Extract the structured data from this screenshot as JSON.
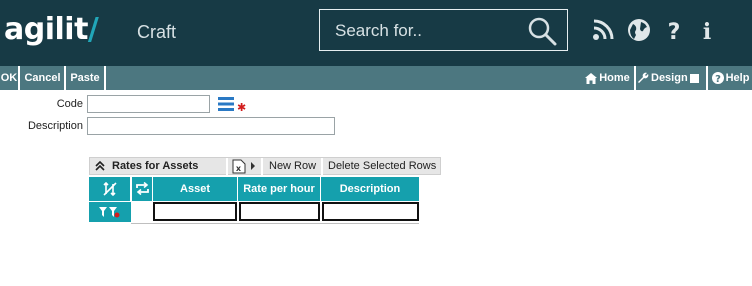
{
  "header": {
    "logo_text": "agilit",
    "logo_slash": "/",
    "app_title": "Craft",
    "search_placeholder": "Search for..",
    "icons": [
      "rss-icon",
      "globe-icon",
      "help-icon",
      "info-icon"
    ],
    "bg_color": "#173a45",
    "accent": "#21a6b8"
  },
  "toolbar": {
    "ok_label": "OK",
    "cancel_label": "Cancel",
    "paste_label": "Paste",
    "home_label": "Home",
    "design_label": "Design",
    "help_label": "Help",
    "bg_color": "#4c7780"
  },
  "form": {
    "code_label": "Code",
    "code_value": "",
    "description_label": "Description",
    "description_value": "",
    "required_marker": "✱"
  },
  "grid": {
    "panel_title": "Rates for Assets",
    "new_row_label": "New Row",
    "delete_rows_label": "Delete Selected Rows",
    "columns": [
      "Asset",
      "Rate per hour",
      "Description"
    ],
    "rows": [
      {
        "asset": "",
        "rate_per_hour": "",
        "description": ""
      }
    ],
    "header_color": "#15a0ad"
  }
}
